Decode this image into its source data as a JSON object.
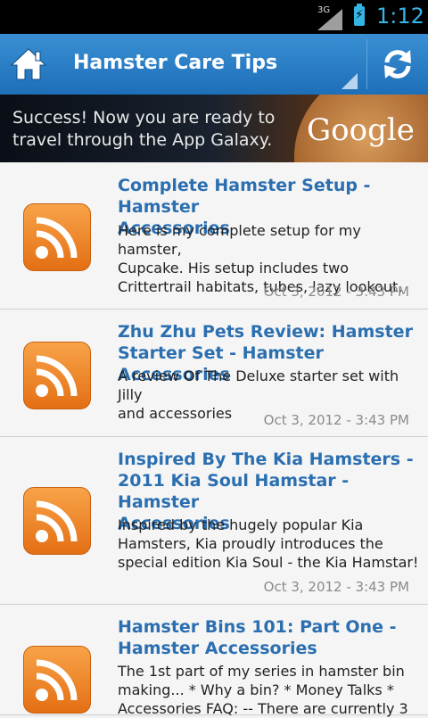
{
  "status": {
    "network": "3G",
    "time": "1:12"
  },
  "app": {
    "title": "Hamster Care Tips"
  },
  "ad": {
    "text_line1": "Success! Now you are ready to",
    "text_line2": "travel through the App Galaxy.",
    "brand": "Google"
  },
  "items": [
    {
      "title_lines": [
        "Complete Hamster Setup - Hamster",
        "Accessories"
      ],
      "desc_lines": [
        "Here is my complete setup for my hamster,",
        "Cupcake. His setup includes two",
        "Crittertrail habitats, tubes, lazy lookout,"
      ],
      "date": "Oct 3, 2012 - 3:43 PM"
    },
    {
      "title_lines": [
        "Zhu Zhu Pets Review: Hamster",
        "Starter Set - Hamster Accessories"
      ],
      "desc_lines": [
        "A review Of The Deluxe starter set with Jilly",
        "and accessories"
      ],
      "date": "Oct 3, 2012 - 3:43 PM"
    },
    {
      "title_lines": [
        "Inspired By The Kia Hamsters -",
        "2011 Kia Soul Hamstar - Hamster",
        "Accessories"
      ],
      "desc_lines": [
        "Inspired by the hugely popular Kia",
        "Hamsters, Kia proudly introduces the",
        "special edition Kia Soul - the Kia Hamstar!"
      ],
      "date": "Oct 3, 2012 - 3:43 PM"
    },
    {
      "title_lines": [
        "Hamster Bins 101: Part One -",
        "Hamster Accessories"
      ],
      "desc_lines": [
        "The 1st part of my series in hamster bin",
        "making... * Why a bin? * Money Talks *",
        "Accessories FAQ: -- There are currently 3"
      ],
      "date": ""
    }
  ]
}
